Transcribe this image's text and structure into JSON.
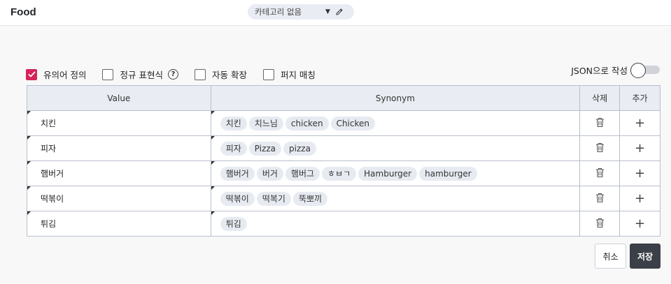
{
  "header": {
    "title": "Food",
    "category": "카테고리 없음"
  },
  "options": [
    {
      "label": "유의어 정의",
      "checked": true
    },
    {
      "label": "정규 표현식",
      "checked": false,
      "help": "?"
    },
    {
      "label": "자동 확장",
      "checked": false
    },
    {
      "label": "퍼지 매칭",
      "checked": false
    }
  ],
  "json_toggle": {
    "label": "JSON으로 작성",
    "on": false
  },
  "table": {
    "headers": {
      "value": "Value",
      "synonym": "Synonym",
      "delete": "삭제",
      "add": "추가"
    },
    "rows": [
      {
        "value": "치킨",
        "synonyms": [
          "치킨",
          "치느님",
          "chicken",
          "Chicken"
        ]
      },
      {
        "value": "피자",
        "synonyms": [
          "피자",
          "Pizza",
          "pizza"
        ]
      },
      {
        "value": "햄버거",
        "synonyms": [
          "햄버거",
          "버거",
          "햄버그",
          "ㅎㅂㄱ",
          "Hamburger",
          "hamburger"
        ]
      },
      {
        "value": "떡볶이",
        "synonyms": [
          "떡볶이",
          "떡복기",
          "뚝뽀끼"
        ]
      },
      {
        "value": "튀김",
        "synonyms": [
          "튀김"
        ]
      }
    ],
    "add_symbol": "+"
  },
  "buttons": {
    "cancel": "취소",
    "save": "저장"
  },
  "colors": {
    "accent": "#d6245a",
    "primary_button": "#3b3f47",
    "header_bg": "#e9ecf2",
    "chip_bg": "#e7ebf1"
  }
}
